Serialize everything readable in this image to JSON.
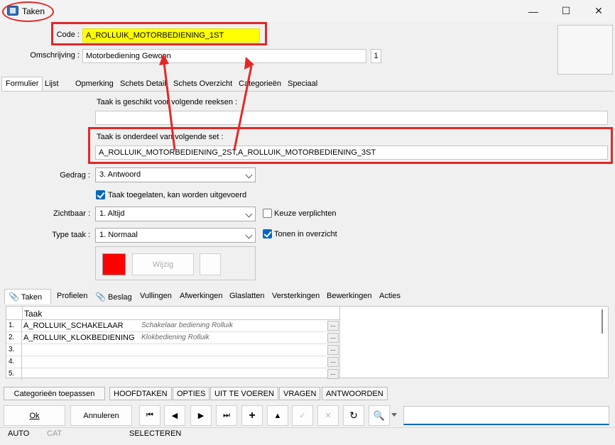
{
  "window": {
    "title": "Taken",
    "minimize": "—",
    "maximize": "☐",
    "close": "✕"
  },
  "code": {
    "label": "Code :",
    "value": "A_ROLLUIK_MOTORBEDIENING_1ST"
  },
  "omschrijving": {
    "label": "Omschrijving :",
    "value": "Motorbediening Gewoon",
    "badge": "1"
  },
  "tabs_top": [
    "Formulier",
    "Lijst",
    "Opmerking",
    "Schets Detail",
    "Schets Overzicht",
    "Categorieën",
    "Speciaal"
  ],
  "formulier": {
    "reeksen_label": "Taak is geschikt voor volgende reeksen :",
    "reeksen_value": "",
    "set_label": "Taak is onderdeel van volgende set :",
    "set_value": "A_ROLLUIK_MOTORBEDIENING_2ST,A_ROLLUIK_MOTORBEDIENING_3ST",
    "gedrag_label": "Gedrag :",
    "gedrag_value": "3.  Antwoord",
    "toegelaten_label": "Taak toegelaten, kan worden uitgevoerd",
    "zichtbaar_label": "Zichtbaar :",
    "zichtbaar_value": "1.  Altijd",
    "keuze_label": "Keuze verplichten",
    "type_label": "Type taak :",
    "type_value": "1.  Normaal",
    "tonen_label": "Tonen in overzicht",
    "wijzig_label": "Wijzig",
    "color": "#ff0000"
  },
  "tabs_bottom": [
    "Taken",
    "Profielen",
    "Beslag",
    "Vullingen",
    "Afwerkingen",
    "Glaslatten",
    "Versterkingen",
    "Bewerkingen",
    "Acties"
  ],
  "grid": {
    "header": "Taak",
    "rows": [
      {
        "num": "1.",
        "code": "A_ROLLUIK_SCHAKELAAR",
        "desc": "Schakelaar bediening Rolluik",
        "ellipsis": "..."
      },
      {
        "num": "2.",
        "code": "A_ROLLUIK_KLOKBEDIENING",
        "desc": "Klokbediening Rolluik",
        "ellipsis": "..."
      },
      {
        "num": "3.",
        "code": "",
        "desc": "",
        "ellipsis": "..."
      },
      {
        "num": "4.",
        "code": "",
        "desc": "",
        "ellipsis": "..."
      },
      {
        "num": "5.",
        "code": "",
        "desc": "",
        "ellipsis": "..."
      }
    ]
  },
  "strip_buttons": [
    "Categorieën toepassen",
    "HOOFDTAKEN",
    "OPTIES",
    "UIT TE VOEREN",
    "VRAGEN",
    "ANTWOORDEN"
  ],
  "actions": {
    "ok": "Ok",
    "annuleren": "Annuleren"
  },
  "nav_icons": [
    "first-icon",
    "prev-icon",
    "next-icon",
    "last-icon",
    "add-icon",
    "up-icon",
    "check-icon",
    "cancel-icon",
    "refresh-icon",
    "binoculars-icon"
  ],
  "search": {
    "value": ""
  },
  "status": {
    "auto": "AUTO",
    "cat": "CAT",
    "mode": "SELECTEREN"
  },
  "accent": {
    "annotation": "#e32828",
    "focus": "#0067c0"
  }
}
